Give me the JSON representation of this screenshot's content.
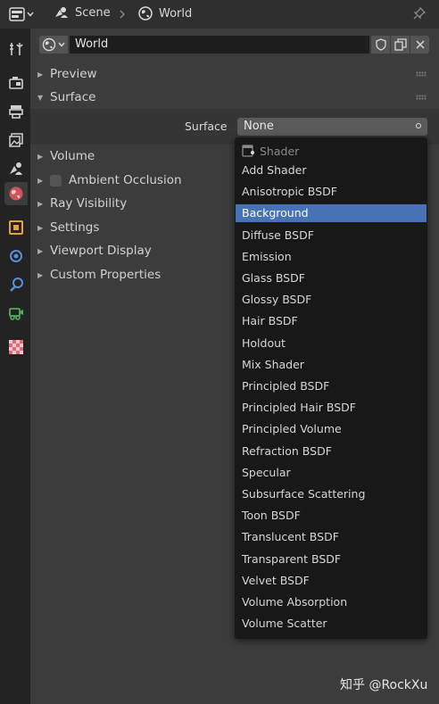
{
  "header": {
    "scene_label": "Scene",
    "world_label": "World"
  },
  "left_tabs": [
    "tool-tab",
    "render-tab",
    "output-tab",
    "view-layer-tab",
    "scene-tab",
    "world-tab",
    "object-tab",
    "modifiers-tab",
    "particles-tab",
    "physics-tab",
    "texture-tab"
  ],
  "world_field": {
    "value": "World"
  },
  "panels": {
    "preview": "Preview",
    "surface": "Surface",
    "volume": "Volume",
    "ambient_occlusion": "Ambient Occlusion",
    "ray_visibility": "Ray Visibility",
    "settings": "Settings",
    "viewport_display": "Viewport Display",
    "custom_properties": "Custom Properties"
  },
  "surface_row": {
    "label": "Surface",
    "value": "None"
  },
  "menu": {
    "title": "Shader",
    "items": [
      "Add Shader",
      "Anisotropic BSDF",
      "Background",
      "Diffuse BSDF",
      "Emission",
      "Glass BSDF",
      "Glossy BSDF",
      "Hair BSDF",
      "Holdout",
      "Mix Shader",
      "Principled BSDF",
      "Principled Hair BSDF",
      "Principled Volume",
      "Refraction BSDF",
      "Specular",
      "Subsurface Scattering",
      "Toon BSDF",
      "Translucent BSDF",
      "Transparent BSDF",
      "Velvet BSDF",
      "Volume Absorption",
      "Volume Scatter"
    ],
    "selected": "Background"
  },
  "watermark": "知乎 @RockXu",
  "colors": {
    "accent": "#4772b3",
    "world_icon": "#d1535a",
    "object_icon": "#e8a03a",
    "physics_icon": "#4fae5b",
    "modifier_icon": "#5a8ed8"
  }
}
